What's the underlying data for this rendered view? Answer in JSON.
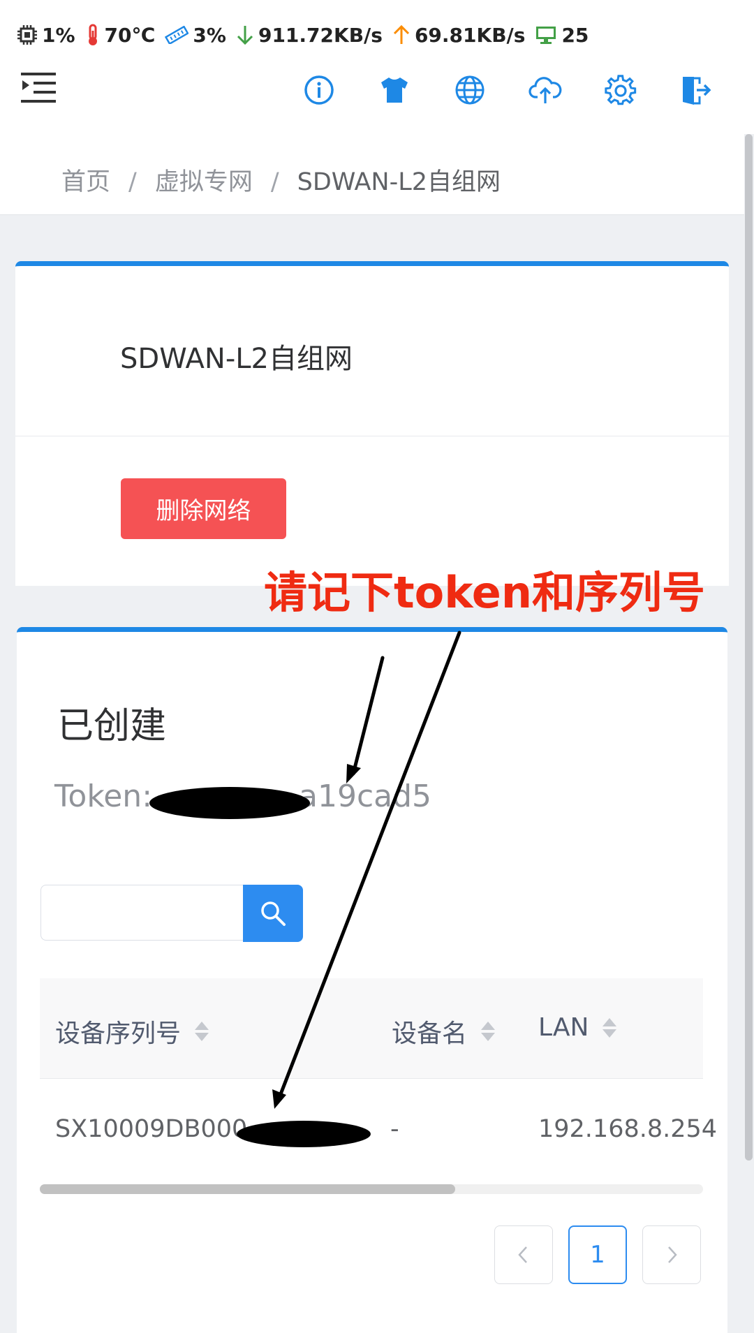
{
  "status_bar": {
    "cpu": "1%",
    "temperature": "70℃",
    "memory": "3%",
    "download": "911.72KB/s",
    "upload": "69.81KB/s",
    "clients": "25",
    "colors": {
      "temp": "#e53935",
      "mem": "#1e88e5",
      "down": "#43a047",
      "up": "#fb8c00",
      "clients": "#43a047"
    }
  },
  "header": {
    "menu_icon": "menu-indent-icon",
    "toolbar_icons": [
      "info-icon",
      "theme-shirt-icon",
      "globe-icon",
      "cloud-upload-icon",
      "gear-icon",
      "logout-icon"
    ],
    "accent": "#1e88e5"
  },
  "breadcrumb": [
    "首页",
    "虚拟专网",
    "SDWAN-L2自组网"
  ],
  "network_card": {
    "title": "SDWAN-L2自组网",
    "delete_button": "删除网络",
    "delete_color": "#f55254"
  },
  "created_card": {
    "title": "已创建",
    "token_label": "Token:",
    "token_visible_suffix": "a19cad5",
    "search": {
      "placeholder": "",
      "value": ""
    },
    "table": {
      "columns": [
        "设备序列号",
        "设备名",
        "LAN"
      ],
      "rows": [
        {
          "serial": "SX10009DB000",
          "name": "-",
          "lan": "192.168.8.254"
        }
      ]
    },
    "pagination": {
      "prev": "<",
      "current": "1",
      "next": ">"
    }
  },
  "annotation": {
    "text": "请记下token和序列号",
    "color": "#ef2b12"
  }
}
